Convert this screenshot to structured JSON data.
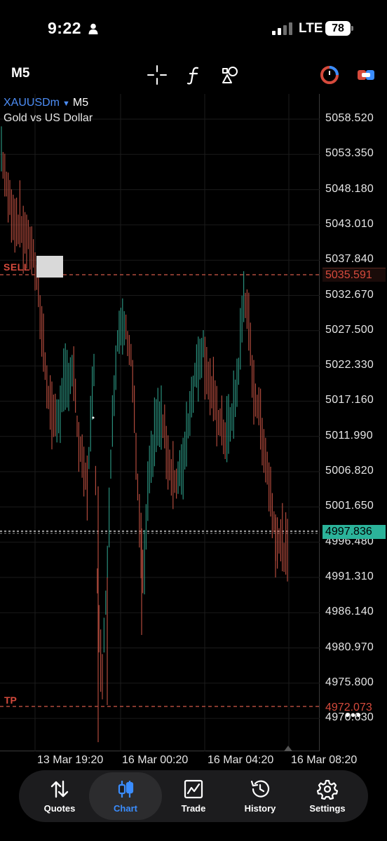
{
  "status_bar": {
    "time": "9:22",
    "network": "LTE",
    "battery": "78"
  },
  "toolbar": {
    "timeframe": "M5",
    "icons": [
      "crosshair-icon",
      "function-icon",
      "objects-icon",
      "one-click-trading-icon",
      "order-toggle-icon"
    ]
  },
  "chart": {
    "symbol": "XAUUSDm",
    "timeframe": "M5",
    "description": "Gold vs US Dollar",
    "price_levels": [
      "5058.520",
      "5053.350",
      "5048.180",
      "5043.010",
      "5037.840",
      "5032.670",
      "5027.500",
      "5022.330",
      "5017.160",
      "5011.990",
      "5006.820",
      "5001.650",
      "4996.480",
      "4991.310",
      "4986.140",
      "4980.970",
      "4975.800",
      "4970.630"
    ],
    "sell_label": "SELL",
    "sell_price": "5035.591",
    "bid_price": "4997.836",
    "tp_label": "TP",
    "tp_price": "4972.073",
    "time_labels": [
      "13 Mar 19:20",
      "16 Mar 00:20",
      "16 Mar 04:20",
      "16 Mar 08:20"
    ],
    "colors": {
      "up": "#2a8f7c",
      "down": "#b04a3c",
      "sell": "#d64a3c",
      "bid_tag": "#2bb39a",
      "symbol": "#4d8ef7"
    }
  },
  "nav": {
    "items": [
      {
        "label": "Quotes",
        "icon": "quotes-arrows-icon"
      },
      {
        "label": "Chart",
        "icon": "candles-chart-icon",
        "active": true
      },
      {
        "label": "Trade",
        "icon": "trade-chart-icon"
      },
      {
        "label": "History",
        "icon": "history-clock-icon"
      },
      {
        "label": "Settings",
        "icon": "settings-gear-icon"
      }
    ]
  }
}
